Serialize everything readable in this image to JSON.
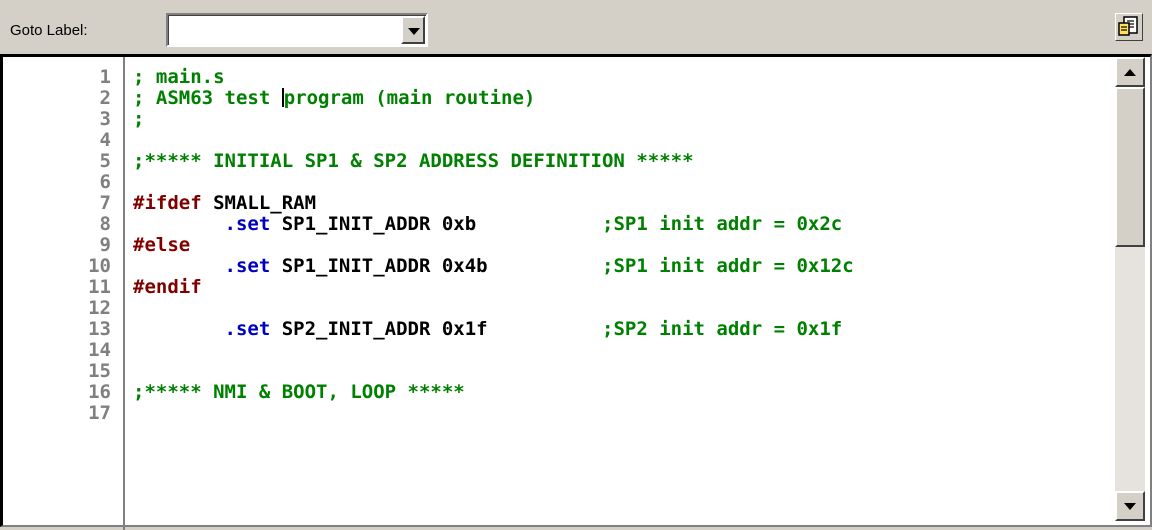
{
  "toolbar": {
    "goto_label": "Goto Label:",
    "goto_value": "",
    "tool_icon": "document-properties-icon"
  },
  "editor": {
    "lines": [
      {
        "num": "1",
        "segments": [
          {
            "cls": "comment",
            "text": "; main.s"
          }
        ]
      },
      {
        "num": "2",
        "segments": [
          {
            "cls": "comment",
            "text": "; ASM63 test "
          },
          {
            "cls": "caret",
            "text": ""
          },
          {
            "cls": "comment",
            "text": "program (main routine)"
          }
        ]
      },
      {
        "num": "3",
        "segments": [
          {
            "cls": "comment",
            "text": ";"
          }
        ]
      },
      {
        "num": "4",
        "segments": []
      },
      {
        "num": "5",
        "segments": [
          {
            "cls": "comment",
            "text": ";***** INITIAL SP1 & SP2 ADDRESS DEFINITION *****"
          }
        ]
      },
      {
        "num": "6",
        "segments": []
      },
      {
        "num": "7",
        "segments": [
          {
            "cls": "pre",
            "text": "#ifdef"
          },
          {
            "cls": "plain",
            "text": " SMALL_RAM"
          }
        ]
      },
      {
        "num": "8",
        "segments": [
          {
            "cls": "plain",
            "text": "        "
          },
          {
            "cls": "dir",
            "text": ".set"
          },
          {
            "cls": "plain",
            "text": " SP1_INIT_ADDR 0xb           "
          },
          {
            "cls": "comment",
            "text": ";SP1 init addr = 0x2c"
          }
        ]
      },
      {
        "num": "9",
        "segments": [
          {
            "cls": "pre",
            "text": "#else"
          }
        ]
      },
      {
        "num": "10",
        "segments": [
          {
            "cls": "plain",
            "text": "        "
          },
          {
            "cls": "dir",
            "text": ".set"
          },
          {
            "cls": "plain",
            "text": " SP1_INIT_ADDR 0x4b          "
          },
          {
            "cls": "comment",
            "text": ";SP1 init addr = 0x12c"
          }
        ]
      },
      {
        "num": "11",
        "segments": [
          {
            "cls": "pre",
            "text": "#endif"
          }
        ]
      },
      {
        "num": "12",
        "segments": []
      },
      {
        "num": "13",
        "segments": [
          {
            "cls": "plain",
            "text": "        "
          },
          {
            "cls": "dir",
            "text": ".set"
          },
          {
            "cls": "plain",
            "text": " SP2_INIT_ADDR 0x1f          "
          },
          {
            "cls": "comment",
            "text": ";SP2 init addr = 0x1f"
          }
        ]
      },
      {
        "num": "14",
        "segments": []
      },
      {
        "num": "15",
        "segments": []
      },
      {
        "num": "16",
        "segments": [
          {
            "cls": "comment",
            "text": ";***** NMI & BOOT, LOOP *****"
          }
        ]
      },
      {
        "num": "17",
        "segments": []
      }
    ]
  },
  "scrollbar": {
    "up_icon": "scroll-up-arrow-icon",
    "down_icon": "scroll-down-arrow-icon"
  }
}
